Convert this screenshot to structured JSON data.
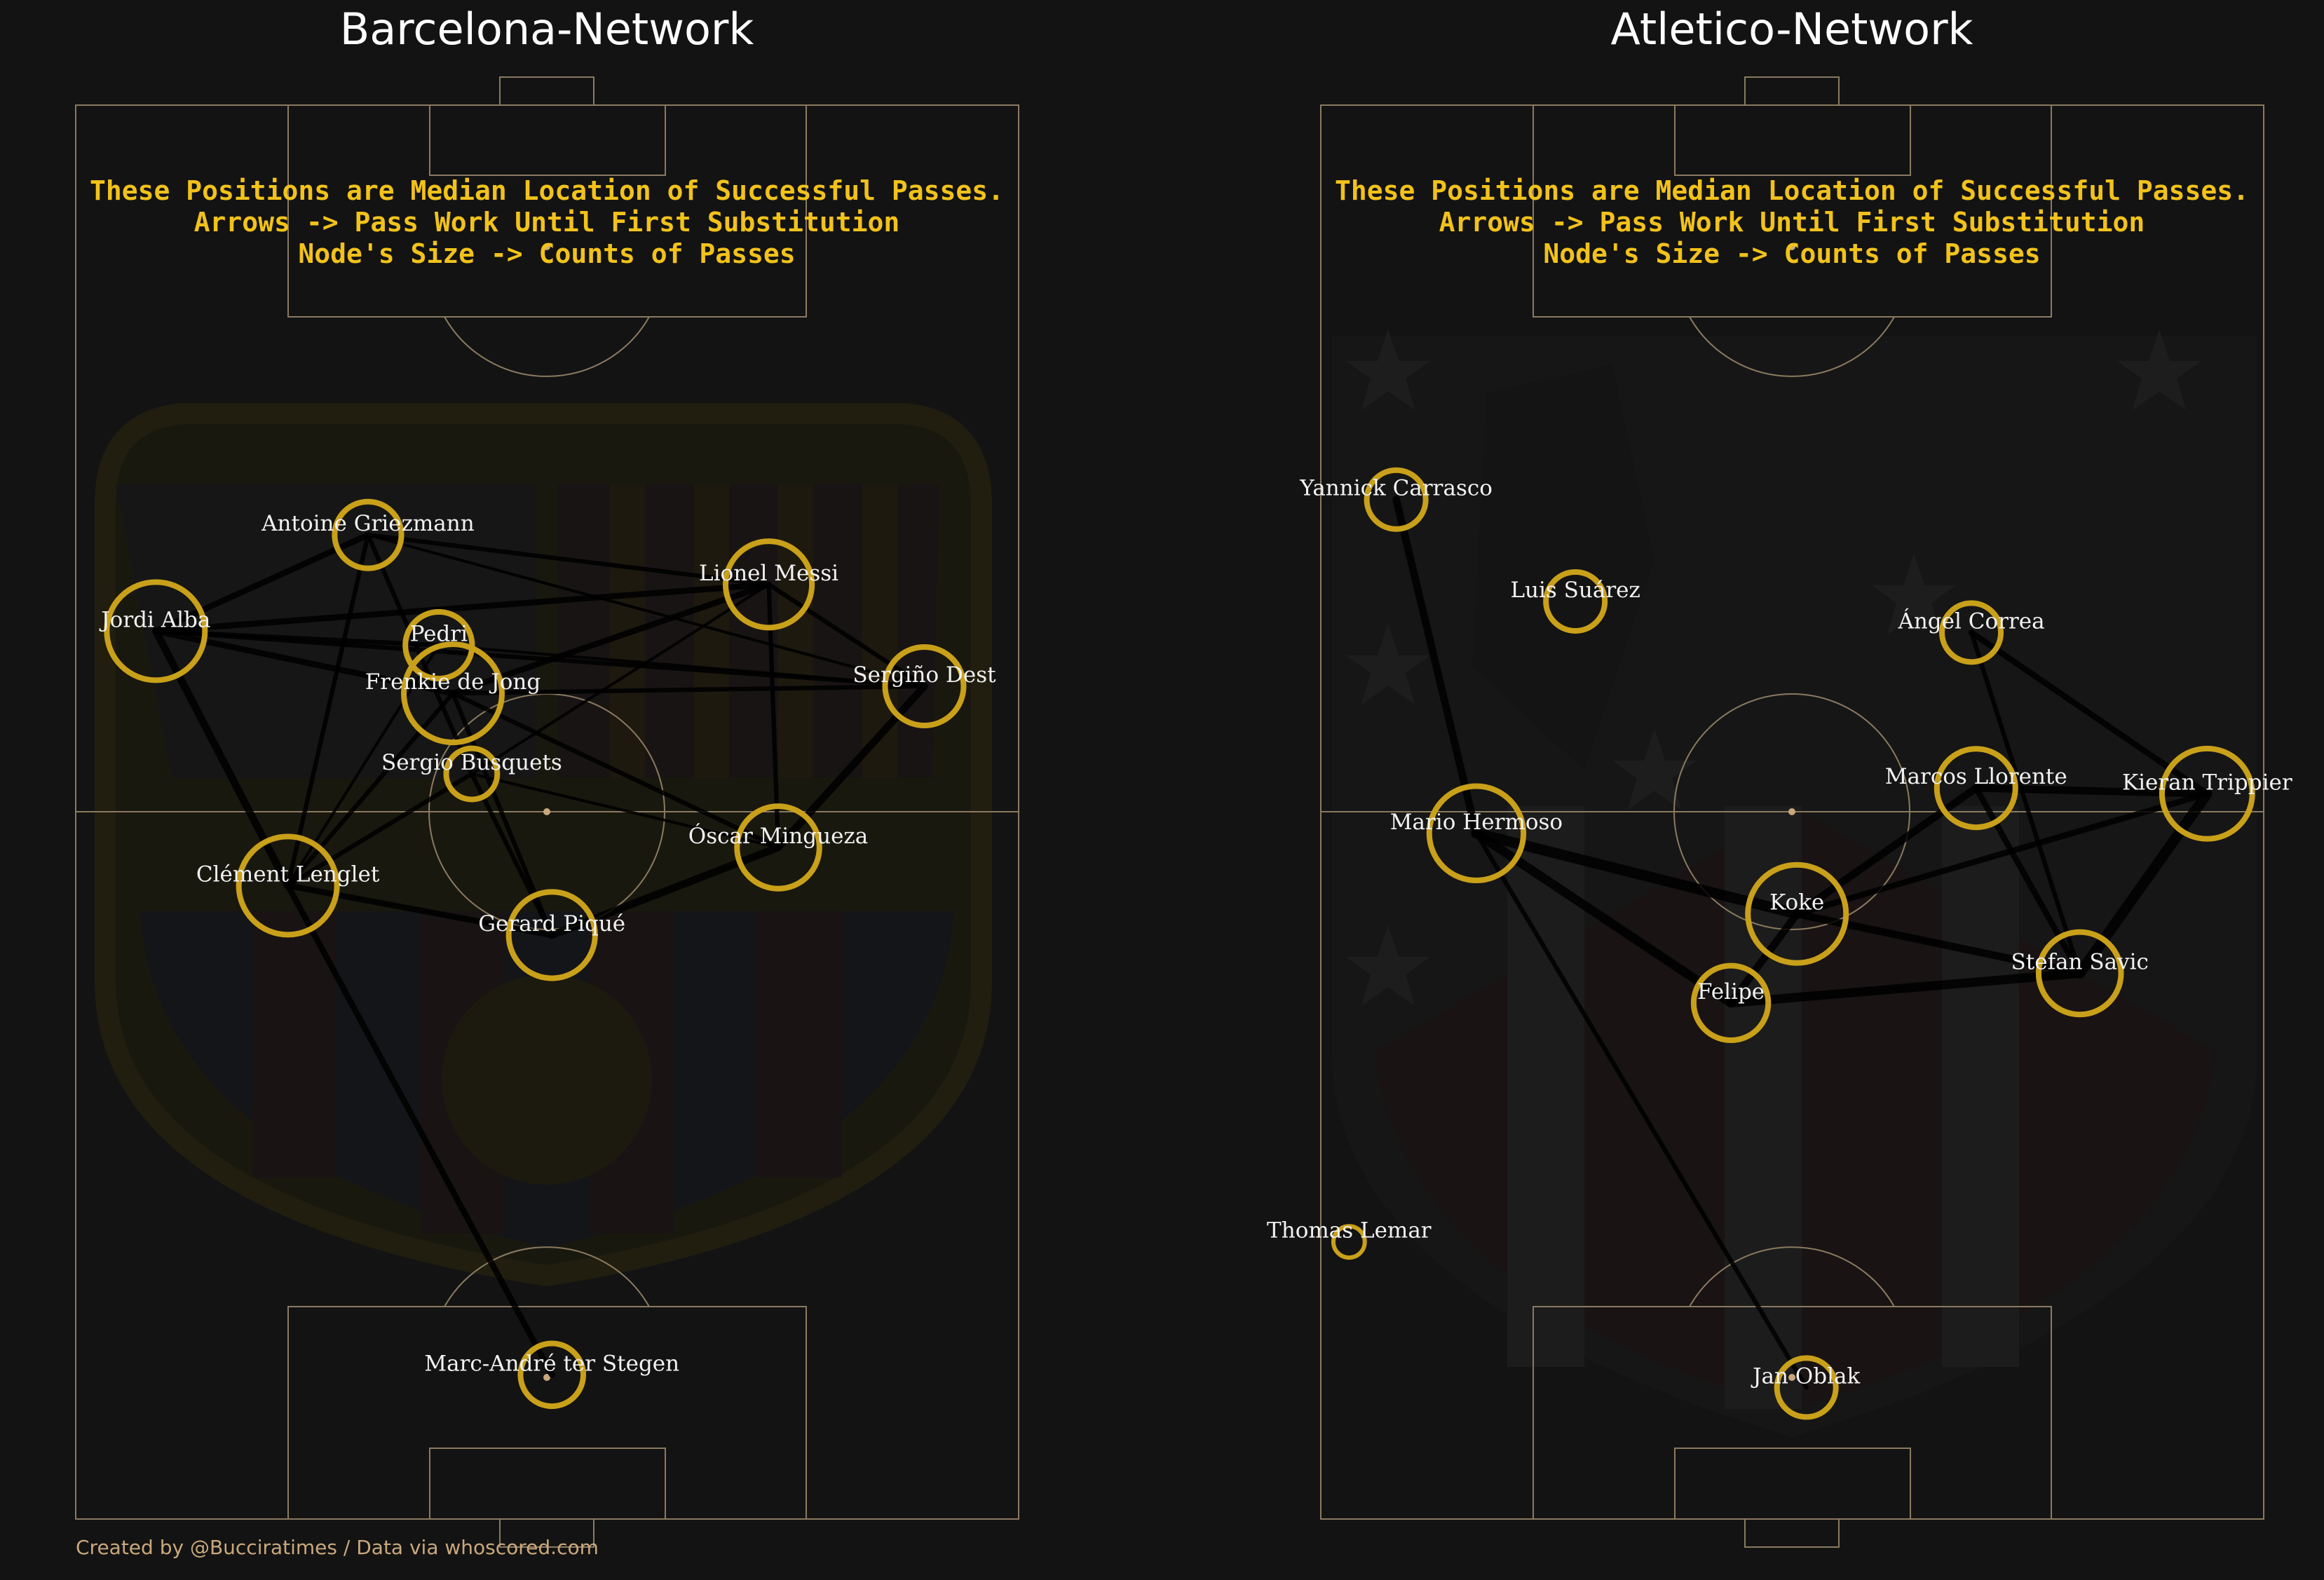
{
  "credit": "Created by @Bucciratimes / Data via whoscored.com",
  "colors": {
    "background": "#131313",
    "pitch_lines": "#8a7a60",
    "node_ring": "#c9a01a",
    "annotation": "#f2c21b",
    "edge": "#000000",
    "label": "#f2f2f2"
  },
  "panels": [
    {
      "id": "barcelona",
      "title": "Barcelona-Network",
      "crest": "barcelona-crest",
      "annotation": [
        "These Positions are Median Location of Successful Passes.",
        "Arrows -> Pass Work Until First Substitution",
        "Node's Size -> Counts of Passes"
      ],
      "nodes": [
        {
          "name": "Antoine Griezmann",
          "x": 31,
          "y": 69.6,
          "size": 0.6
        },
        {
          "name": "Jordi Alba",
          "x": 8.5,
          "y": 62.8,
          "size": 1.0
        },
        {
          "name": "Lionel Messi",
          "x": 73.5,
          "y": 66.1,
          "size": 0.85
        },
        {
          "name": "Pedri",
          "x": 38.5,
          "y": 61.8,
          "size": 0.6
        },
        {
          "name": "Frenkie de Jong",
          "x": 40,
          "y": 58.4,
          "size": 1.0
        },
        {
          "name": "Sergiño Dest",
          "x": 90,
          "y": 58.9,
          "size": 0.75
        },
        {
          "name": "Sergio Busquets",
          "x": 42,
          "y": 52.7,
          "size": 0.4
        },
        {
          "name": "Óscar Mingueza",
          "x": 74.5,
          "y": 47.5,
          "size": 0.8
        },
        {
          "name": "Clément Lenglet",
          "x": 22.5,
          "y": 44.8,
          "size": 1.0
        },
        {
          "name": "Gerard Piqué",
          "x": 50.5,
          "y": 41.3,
          "size": 0.85
        },
        {
          "name": "Marc-André ter Stegen",
          "x": 50.5,
          "y": 10.2,
          "size": 0.55
        }
      ],
      "edges": [
        {
          "from": "Marc-André ter Stegen",
          "to": "Clément Lenglet",
          "weight": 3
        },
        {
          "from": "Clément Lenglet",
          "to": "Jordi Alba",
          "weight": 4
        },
        {
          "from": "Clément Lenglet",
          "to": "Gerard Piqué",
          "weight": 3
        },
        {
          "from": "Clément Lenglet",
          "to": "Antoine Griezmann",
          "weight": 2
        },
        {
          "from": "Clément Lenglet",
          "to": "Frenkie de Jong",
          "weight": 2
        },
        {
          "from": "Clément Lenglet",
          "to": "Sergio Busquets",
          "weight": 2
        },
        {
          "from": "Clément Lenglet",
          "to": "Pedri",
          "weight": 1
        },
        {
          "from": "Gerard Piqué",
          "to": "Óscar Mingueza",
          "weight": 4
        },
        {
          "from": "Gerard Piqué",
          "to": "Sergio Busquets",
          "weight": 2
        },
        {
          "from": "Gerard Piqué",
          "to": "Frenkie de Jong",
          "weight": 2
        },
        {
          "from": "Óscar Mingueza",
          "to": "Sergiño Dest",
          "weight": 4
        },
        {
          "from": "Óscar Mingueza",
          "to": "Lionel Messi",
          "weight": 2
        },
        {
          "from": "Óscar Mingueza",
          "to": "Frenkie de Jong",
          "weight": 2
        },
        {
          "from": "Óscar Mingueza",
          "to": "Sergio Busquets",
          "weight": 1
        },
        {
          "from": "Jordi Alba",
          "to": "Lionel Messi",
          "weight": 3
        },
        {
          "from": "Jordi Alba",
          "to": "Antoine Griezmann",
          "weight": 3
        },
        {
          "from": "Jordi Alba",
          "to": "Frenkie de Jong",
          "weight": 3
        },
        {
          "from": "Jordi Alba",
          "to": "Pedri",
          "weight": 2
        },
        {
          "from": "Jordi Alba",
          "to": "Sergiño Dest",
          "weight": 2
        },
        {
          "from": "Antoine Griezmann",
          "to": "Lionel Messi",
          "weight": 2
        },
        {
          "from": "Antoine Griezmann",
          "to": "Sergiño Dest",
          "weight": 1
        },
        {
          "from": "Antoine Griezmann",
          "to": "Sergio Busquets",
          "weight": 2
        },
        {
          "from": "Pedri",
          "to": "Sergiño Dest",
          "weight": 1
        },
        {
          "from": "Frenkie de Jong",
          "to": "Lionel Messi",
          "weight": 3
        },
        {
          "from": "Frenkie de Jong",
          "to": "Sergiño Dest",
          "weight": 2
        },
        {
          "from": "Lionel Messi",
          "to": "Sergiño Dest",
          "weight": 2
        },
        {
          "from": "Sergio Busquets",
          "to": "Lionel Messi",
          "weight": 1
        }
      ]
    },
    {
      "id": "atletico",
      "title": "Atletico-Network",
      "crest": "atletico-crest",
      "annotation": [
        "These Positions are Median Location of Successful Passes.",
        "Arrows -> Pass Work Until First Substitution",
        "Node's Size -> Counts of Passes"
      ],
      "nodes": [
        {
          "name": "Yannick Carrasco",
          "x": 8,
          "y": 72.1,
          "size": 0.5
        },
        {
          "name": "Luis Suárez",
          "x": 27,
          "y": 64.9,
          "size": 0.5
        },
        {
          "name": "Ángel Correa",
          "x": 69,
          "y": 62.7,
          "size": 0.5
        },
        {
          "name": "Marcos Llorente",
          "x": 69.5,
          "y": 51.7,
          "size": 0.75
        },
        {
          "name": "Kieran Trippier",
          "x": 94,
          "y": 51.3,
          "size": 0.9
        },
        {
          "name": "Mario Hermoso",
          "x": 16.5,
          "y": 48.5,
          "size": 0.95
        },
        {
          "name": "Koke",
          "x": 50.5,
          "y": 42.8,
          "size": 1.0
        },
        {
          "name": "Felipe",
          "x": 43.5,
          "y": 36.5,
          "size": 0.7
        },
        {
          "name": "Stefan Savic",
          "x": 80.5,
          "y": 38.6,
          "size": 0.8
        },
        {
          "name": "Thomas Lemar",
          "x": 3,
          "y": 19.6,
          "size": 0.15
        },
        {
          "name": "Jan Oblak",
          "x": 51.5,
          "y": 9.3,
          "size": 0.5
        }
      ],
      "edges": [
        {
          "from": "Yannick Carrasco",
          "to": "Mario Hermoso",
          "weight": 4
        },
        {
          "from": "Mario Hermoso",
          "to": "Koke",
          "weight": 6
        },
        {
          "from": "Mario Hermoso",
          "to": "Felipe",
          "weight": 5
        },
        {
          "from": "Mario Hermoso",
          "to": "Jan Oblak",
          "weight": 2
        },
        {
          "from": "Koke",
          "to": "Felipe",
          "weight": 4
        },
        {
          "from": "Koke",
          "to": "Marcos Llorente",
          "weight": 4
        },
        {
          "from": "Koke",
          "to": "Kieran Trippier",
          "weight": 3
        },
        {
          "from": "Koke",
          "to": "Stefan Savic",
          "weight": 4
        },
        {
          "from": "Felipe",
          "to": "Stefan Savic",
          "weight": 5
        },
        {
          "from": "Stefan Savic",
          "to": "Kieran Trippier",
          "weight": 6
        },
        {
          "from": "Stefan Savic",
          "to": "Marcos Llorente",
          "weight": 3
        },
        {
          "from": "Stefan Savic",
          "to": "Ángel Correa",
          "weight": 2
        },
        {
          "from": "Marcos Llorente",
          "to": "Kieran Trippier",
          "weight": 4
        },
        {
          "from": "Ángel Correa",
          "to": "Kieran Trippier",
          "weight": 3
        }
      ]
    }
  ]
}
